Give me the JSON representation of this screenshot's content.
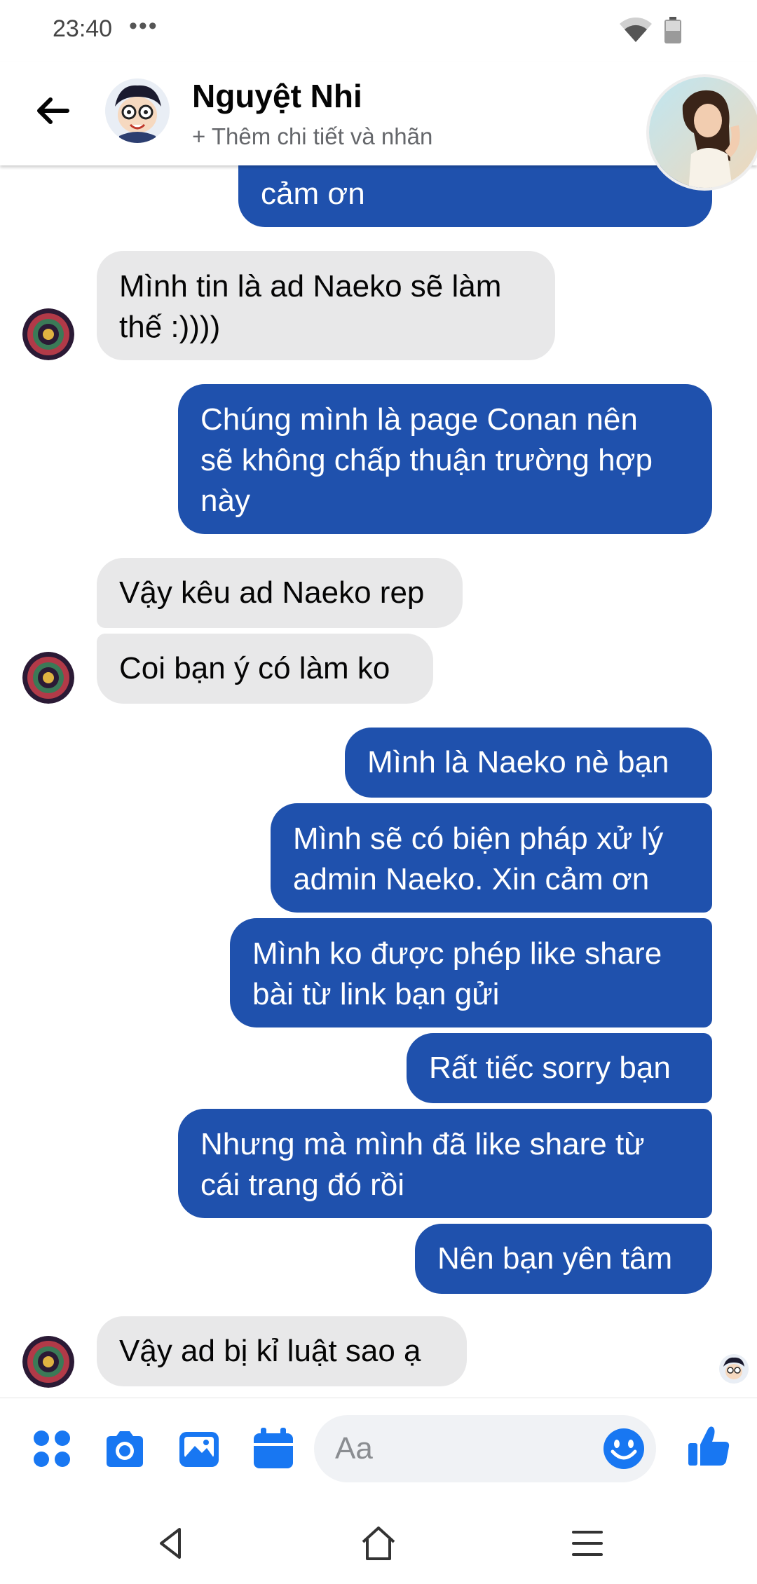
{
  "status_bar": {
    "time": "23:40",
    "dots": "•••"
  },
  "header": {
    "name": "Nguyệt Nhi",
    "subtitle": "+ Thêm chi tiết và nhãn"
  },
  "messages": {
    "m0": "cảm ơn",
    "m1_l1": "Mình tin là ad Naeko sẽ làm",
    "m1_l2": "thế :))))",
    "m2_l1": "Chúng mình là page Conan nên",
    "m2_l2": "sẽ không chấp thuận trường hợp",
    "m2_l3": "này",
    "m3": "Vậy kêu ad Naeko rep",
    "m4": "Coi bạn ý có làm ko",
    "m5": "Mình là Naeko nè bạn",
    "m6_l1": "Mình sẽ có biện pháp xử lý",
    "m6_l2": "admin Naeko. Xin cảm ơn",
    "m7_l1": "Mình ko được phép like share",
    "m7_l2": "bài từ link bạn gửi",
    "m8": "Rất tiếc sorry bạn",
    "m9_l1": "Nhưng mà mình đã like share từ",
    "m9_l2": "cái trang đó rồi",
    "m10": "Nên bạn yên tâm",
    "m11": "Vậy ad bị kỉ luật sao ạ"
  },
  "composer": {
    "placeholder": "Aa"
  },
  "colors": {
    "outgoing": "#1f51ad",
    "incoming": "#e8e8e9",
    "accent": "#1877f2"
  },
  "icons": [
    "back-arrow-icon",
    "menu-grid-icon",
    "camera-icon",
    "photo-icon",
    "calendar-icon",
    "emoji-icon",
    "thumbs-up-icon",
    "nav-back-icon",
    "nav-home-icon",
    "nav-menu-icon"
  ]
}
